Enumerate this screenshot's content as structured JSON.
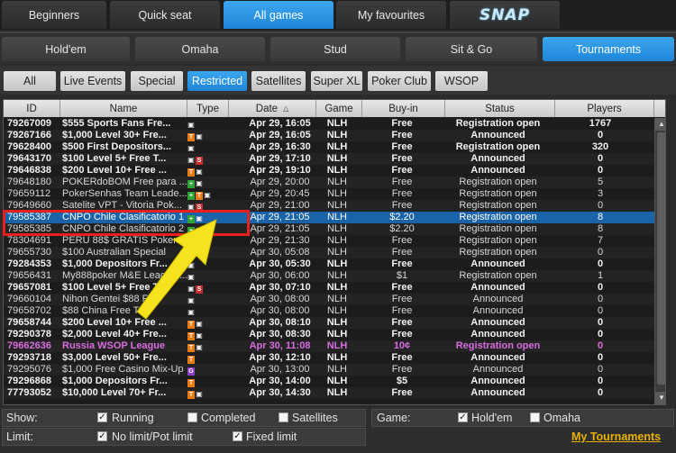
{
  "top_tabs": [
    {
      "label": "Beginners"
    },
    {
      "label": "Quick seat"
    },
    {
      "label": "All games"
    },
    {
      "label": "My favourites"
    },
    {
      "label": "SNAP"
    }
  ],
  "game_tabs": [
    {
      "label": "Hold'em"
    },
    {
      "label": "Omaha"
    },
    {
      "label": "Stud"
    },
    {
      "label": "Sit & Go"
    },
    {
      "label": "Tournaments"
    }
  ],
  "filter_tabs": [
    {
      "label": "All"
    },
    {
      "label": "Live Events"
    },
    {
      "label": "Special"
    },
    {
      "label": "Restricted"
    },
    {
      "label": "Satellites"
    },
    {
      "label": "Super XL"
    },
    {
      "label": "Poker Club"
    },
    {
      "label": "WSOP"
    }
  ],
  "columns": [
    "ID",
    "Name",
    "Type",
    "Date",
    "Game",
    "Buy-in",
    "Status",
    "Players"
  ],
  "rows": [
    {
      "id": "79267009",
      "name": "$555 Sports Fans Fre...",
      "type": [
        "L"
      ],
      "date": "Apr 29, 16:05",
      "game": "NLH",
      "buyin": "Free",
      "status": "Registration open",
      "players": "1767",
      "style": "bold"
    },
    {
      "id": "79267166",
      "name": "$1,000 Level 30+ Fre...",
      "type": [
        "T",
        "L"
      ],
      "date": "Apr 29, 16:05",
      "game": "NLH",
      "buyin": "Free",
      "status": "Announced",
      "players": "0",
      "style": "bold"
    },
    {
      "id": "79628400",
      "name": "$500 First Depositors...",
      "type": [
        "L"
      ],
      "date": "Apr 29, 16:30",
      "game": "NLH",
      "buyin": "Free",
      "status": "Registration open",
      "players": "320",
      "style": "bold"
    },
    {
      "id": "79643170",
      "name": "$100 Level 5+ Free T...",
      "type": [
        "L",
        "S"
      ],
      "date": "Apr 29, 17:10",
      "game": "NLH",
      "buyin": "Free",
      "status": "Announced",
      "players": "0",
      "style": "bold"
    },
    {
      "id": "79646838",
      "name": "$200 Level 10+ Free ...",
      "type": [
        "T",
        "L"
      ],
      "date": "Apr 29, 19:10",
      "game": "NLH",
      "buyin": "Free",
      "status": "Announced",
      "players": "0",
      "style": "bold"
    },
    {
      "id": "79648180",
      "name": "POKERdoBOM Free para ...",
      "type": [
        "P",
        "L"
      ],
      "date": "Apr 29, 20:00",
      "game": "NLH",
      "buyin": "Free",
      "status": "Registration open",
      "players": "5",
      "style": ""
    },
    {
      "id": "79659112",
      "name": "PokerSenhas Team Leade...",
      "type": [
        "P",
        "T",
        "L"
      ],
      "date": "Apr 29, 20:45",
      "game": "NLH",
      "buyin": "Free",
      "status": "Registration open",
      "players": "3",
      "style": ""
    },
    {
      "id": "79649660",
      "name": "Satelite VPT - Vitoria Pok...",
      "type": [
        "L",
        "S"
      ],
      "date": "Apr 29, 21:00",
      "game": "NLH",
      "buyin": "Free",
      "status": "Registration open",
      "players": "0",
      "style": ""
    },
    {
      "id": "79585387",
      "name": "CNPO Chile Clasificatorio 1",
      "type": [
        "P",
        "L"
      ],
      "date": "Apr 29, 21:05",
      "game": "NLH",
      "buyin": "$2.20",
      "status": "Registration open",
      "players": "8",
      "style": "selected"
    },
    {
      "id": "79585385",
      "name": "CNPO Chile Clasificatorio 2",
      "type": [
        "P",
        "L"
      ],
      "date": "Apr 29, 21:05",
      "game": "NLH",
      "buyin": "$2.20",
      "status": "Registration open",
      "players": "8",
      "style": ""
    },
    {
      "id": "78304691",
      "name": "PERU 88$ GRATIS Poker...",
      "type": [
        "P",
        "L"
      ],
      "date": "Apr 29, 21:30",
      "game": "NLH",
      "buyin": "Free",
      "status": "Registration open",
      "players": "7",
      "style": ""
    },
    {
      "id": "79655730",
      "name": "$100 Australian Special",
      "type": [
        "L"
      ],
      "date": "Apr 30, 05:08",
      "game": "NLH",
      "buyin": "Free",
      "status": "Registration open",
      "players": "0",
      "style": ""
    },
    {
      "id": "79284353",
      "name": "$1,000 Depositors Fr...",
      "type": [
        "L"
      ],
      "date": "Apr 30, 05:30",
      "game": "NLH",
      "buyin": "Free",
      "status": "Announced",
      "players": "0",
      "style": "bold"
    },
    {
      "id": "79656431",
      "name": "My888poker M&E League ...",
      "type": [
        "L"
      ],
      "date": "Apr 30, 06:00",
      "game": "NLH",
      "buyin": "$1",
      "status": "Registration open",
      "players": "1",
      "style": ""
    },
    {
      "id": "79657081",
      "name": "$100 Level 5+ Free T...",
      "type": [
        "L",
        "S"
      ],
      "date": "Apr 30, 07:10",
      "game": "NLH",
      "buyin": "Free",
      "status": "Announced",
      "players": "0",
      "style": "bold"
    },
    {
      "id": "79660104",
      "name": "Nihon Gentei $88 Fr...",
      "type": [
        "L"
      ],
      "date": "Apr 30, 08:00",
      "game": "NLH",
      "buyin": "Free",
      "status": "Announced",
      "players": "0",
      "style": ""
    },
    {
      "id": "79658702",
      "name": "$88 China Free To...",
      "type": [
        "L"
      ],
      "date": "Apr 30, 08:00",
      "game": "NLH",
      "buyin": "Free",
      "status": "Announced",
      "players": "0",
      "style": ""
    },
    {
      "id": "79658744",
      "name": "$200 Level 10+ Free ...",
      "type": [
        "T",
        "L"
      ],
      "date": "Apr 30, 08:10",
      "game": "NLH",
      "buyin": "Free",
      "status": "Announced",
      "players": "0",
      "style": "bold"
    },
    {
      "id": "79290378",
      "name": "$2,000 Level 40+ Fre...",
      "type": [
        "T",
        "L"
      ],
      "date": "Apr 30, 08:30",
      "game": "NLH",
      "buyin": "Free",
      "status": "Announced",
      "players": "0",
      "style": "bold"
    },
    {
      "id": "79662636",
      "name": "Russia WSOP League",
      "type": [
        "T",
        "L"
      ],
      "date": "Apr 30, 11:08",
      "game": "NLH",
      "buyin": "10¢",
      "status": "Registration open",
      "players": "0",
      "style": "pink"
    },
    {
      "id": "79293718",
      "name": "$3,000 Level 50+ Fre...",
      "type": [
        "T"
      ],
      "date": "Apr 30, 12:10",
      "game": "NLH",
      "buyin": "Free",
      "status": "Announced",
      "players": "0",
      "style": "bold"
    },
    {
      "id": "79295076",
      "name": "$1,000 Free Casino Mix-Up",
      "type": [
        "G"
      ],
      "date": "Apr 30, 13:00",
      "game": "NLH",
      "buyin": "Free",
      "status": "Announced",
      "players": "0",
      "style": ""
    },
    {
      "id": "79296868",
      "name": "$1,000 Depositors Fr...",
      "type": [
        "T"
      ],
      "date": "Apr 30, 14:00",
      "game": "NLH",
      "buyin": "$5",
      "status": "Announced",
      "players": "0",
      "style": "bold"
    },
    {
      "id": "77793052",
      "name": "$10,000 Level 70+ Fr...",
      "type": [
        "T",
        "L"
      ],
      "date": "Apr 30, 14:30",
      "game": "NLH",
      "buyin": "Free",
      "status": "Announced",
      "players": "0",
      "style": "bold"
    }
  ],
  "bottom": {
    "show_label": "Show:",
    "running_label": "Running",
    "completed_label": "Completed",
    "satellites_label": "Satellites",
    "game_label": "Game:",
    "holdem_label": "Hold'em",
    "omaha_label": "Omaha",
    "limit_label": "Limit:",
    "nolimit_label": "No limit/Pot limit",
    "fixed_label": "Fixed limit",
    "my_tournaments": "My Tournaments"
  },
  "checks": {
    "running": "✓",
    "completed": "",
    "satellites": "",
    "holdem": "✓",
    "omaha": "",
    "nolimit": "✓",
    "fixed": "✓"
  },
  "colors": {
    "accent": "#1e86d8",
    "selected_row": "#1a63a8",
    "wsop_pink": "#d96ce0",
    "link_gold": "#e8b100",
    "highlight_red": "#e8201c",
    "arrow_yellow": "#f5e31d"
  },
  "icons": {
    "sort": "sort-up-icon",
    "lock": "lock-icon",
    "snap_logo": "snap-logo-icon"
  }
}
